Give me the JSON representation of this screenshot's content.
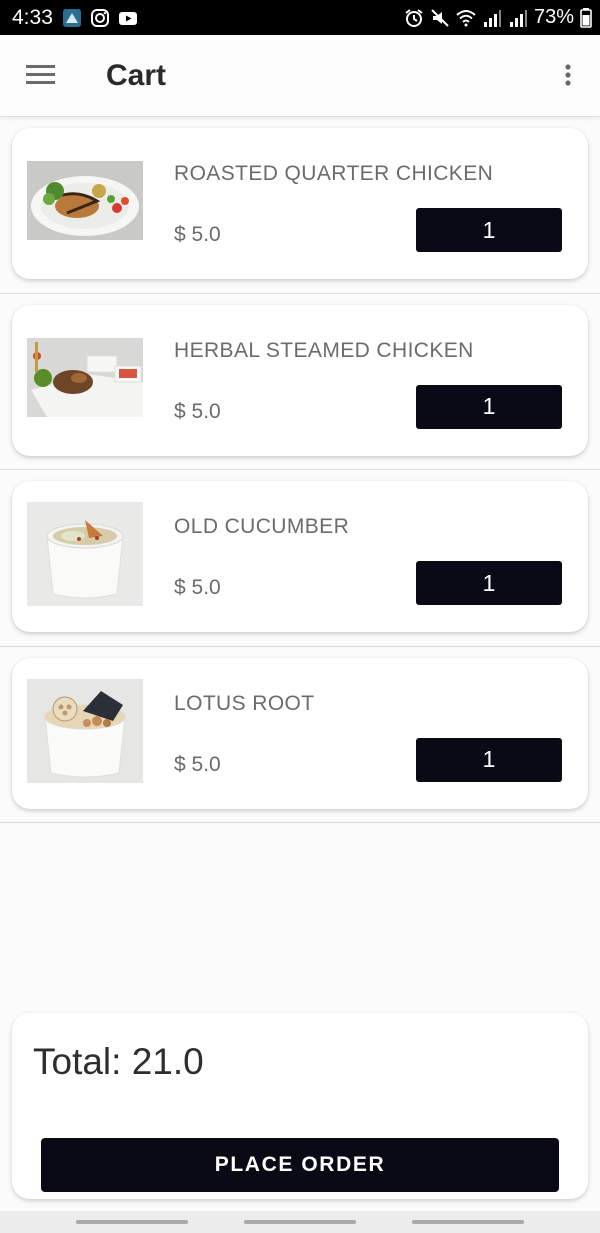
{
  "status_bar": {
    "time": "4:33",
    "battery": "73%",
    "left_icons": [
      "app-icon",
      "instagram-icon",
      "youtube-icon"
    ],
    "right_icons": [
      "alarm-icon",
      "mute-icon",
      "wifi-icon",
      "signal-icon",
      "signal-icon",
      "battery-icon"
    ]
  },
  "app_bar": {
    "title": "Cart"
  },
  "cart": {
    "items": [
      {
        "name": "ROASTED QUARTER CHICKEN",
        "price": "$ 5.0",
        "quantity": "1",
        "image": "roasted-chicken-plate"
      },
      {
        "name": "HERBAL STEAMED CHICKEN",
        "price": "$ 5.0",
        "quantity": "1",
        "image": "steamed-chicken-tray"
      },
      {
        "name": "OLD CUCUMBER",
        "price": "$ 5.0",
        "quantity": "1",
        "image": "cucumber-soup-cup"
      },
      {
        "name": "LOTUS ROOT",
        "price": "$ 5.0",
        "quantity": "1",
        "image": "lotus-root-soup-cup"
      }
    ]
  },
  "footer": {
    "total": "Total: 21.0",
    "place_order": "PLACE ORDER"
  },
  "colors": {
    "accent": "#0a0a17",
    "status_bar": "#000000",
    "text_secondary": "#6b6b6b"
  }
}
